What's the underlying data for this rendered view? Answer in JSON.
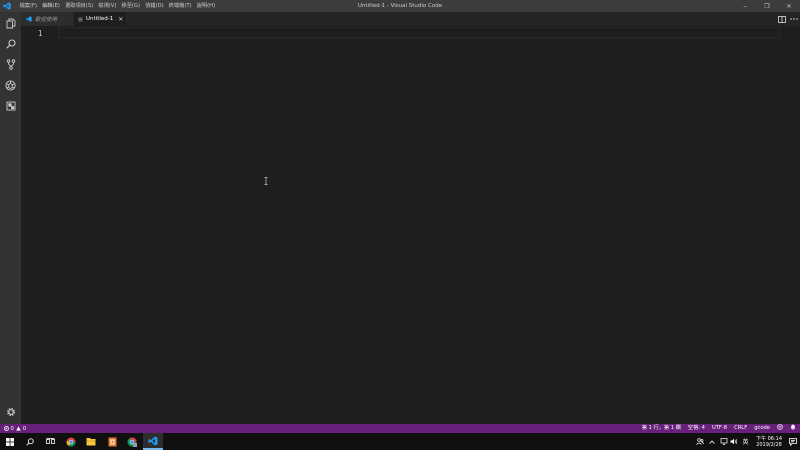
{
  "titlebar": {
    "menus": [
      "檔案(F)",
      "編輯(E)",
      "選取項目(S)",
      "檢視(V)",
      "移至(G)",
      "偵錯(D)",
      "終端機(T)",
      "說明(H)"
    ],
    "title": "Untitled-1 - Visual Studio Code",
    "minimize": "–",
    "maximize": "❐",
    "close": "✕"
  },
  "tabs": {
    "welcome": "歡迎使用",
    "untitled": "Untitled-1",
    "close": "✕"
  },
  "editor": {
    "line_number": "1"
  },
  "statusbar": {
    "errors": "0",
    "warnings": "0",
    "position": "第 1 行，第 1 欄",
    "spaces": "空格: 4",
    "encoding": "UTF-8",
    "eol": "CRLF",
    "language": "gcode"
  },
  "taskbar": {
    "ime": "英",
    "time": "下午 06:14",
    "date": "2019/2/28"
  },
  "colors": {
    "statusbar": "#68217a",
    "vscode_blue": "#1f9cf0",
    "editor_bg": "#1e1e1e"
  }
}
